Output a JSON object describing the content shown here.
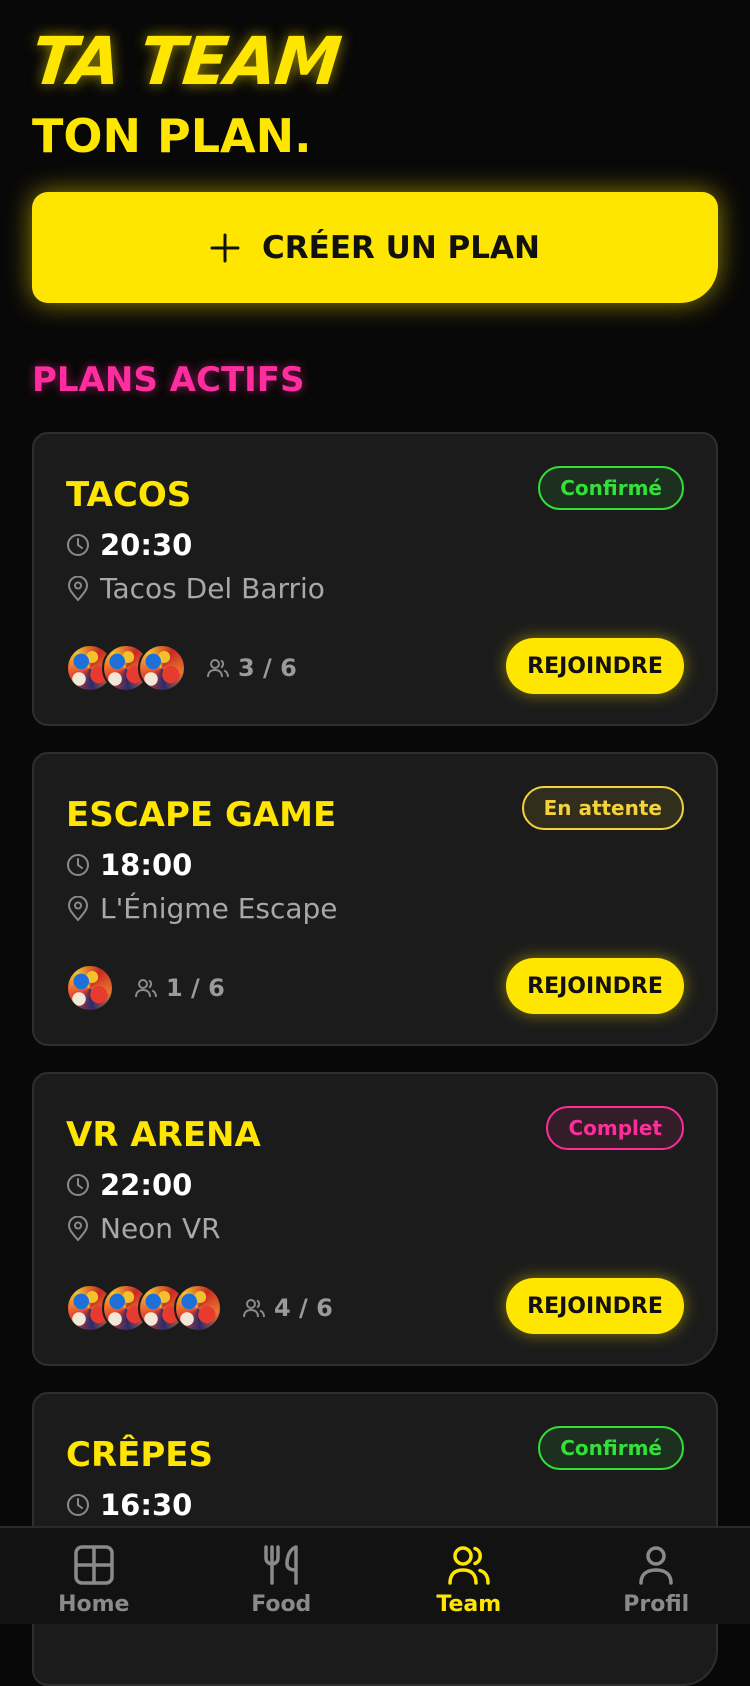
{
  "header": {
    "title": "TA TEAM",
    "subtitle": "TON PLAN."
  },
  "create_button": {
    "label": "CRÉER UN PLAN",
    "icon": "plus-icon"
  },
  "section": {
    "title": "PLANS ACTIFS"
  },
  "plans": [
    {
      "title": "TACOS",
      "status": "Confirmé",
      "time": "20:30",
      "location": "Tacos Del Barrio",
      "members": "3 / 6",
      "join_label": "REJOINDRE"
    },
    {
      "title": "ESCAPE GAME",
      "status": "En attente",
      "time": "18:00",
      "location": "L'Énigme Escape",
      "members": "1 / 6",
      "join_label": "REJOINDRE"
    },
    {
      "title": "VR ARENA",
      "status": "Complet",
      "time": "22:00",
      "location": "Neon VR",
      "members": "4 / 6",
      "join_label": "REJOINDRE"
    },
    {
      "title": "CRÊPES",
      "status": "Confirmé",
      "time": "16:30"
    }
  ],
  "nav": {
    "items": [
      {
        "label": "Home",
        "icon": "grid-icon"
      },
      {
        "label": "Food",
        "icon": "fork-knife-icon"
      },
      {
        "label": "Team",
        "icon": "users-icon",
        "active": true
      },
      {
        "label": "Profil",
        "icon": "user-icon"
      }
    ]
  },
  "colors": {
    "accent_yellow": "#FFE600",
    "accent_pink": "#FF2DA0",
    "status_confirmed": "#33E03A",
    "status_pending": "#F2D33A",
    "status_full": "#FF2D9B",
    "background": "#080808",
    "card": "#1B1B1B"
  }
}
